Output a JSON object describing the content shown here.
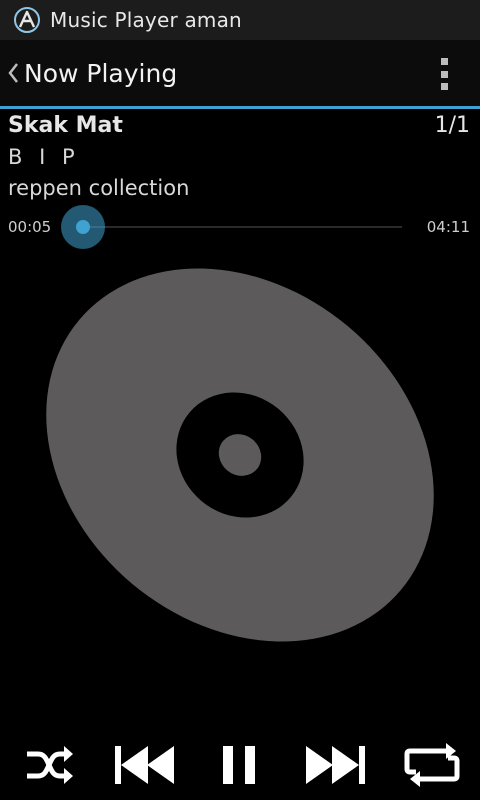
{
  "status_bar": {
    "app_title": "Music Player aman",
    "logo_icon": "app-logo-icon"
  },
  "action_bar": {
    "back_icon": "chevron-left-icon",
    "title": "Now Playing",
    "menu_icon": "overflow-menu-icon"
  },
  "track": {
    "title": "Skak Mat",
    "index": "1/1",
    "artist": "B I P",
    "album": "reppen collection"
  },
  "seek": {
    "elapsed": "00:05",
    "total": "04:11",
    "progress": 0.02
  },
  "album_art": {
    "icon": "disc-icon"
  },
  "controls": {
    "shuffle_icon": "shuffle-icon",
    "previous_icon": "skip-previous-icon",
    "pause_icon": "pause-icon",
    "next_icon": "skip-next-icon",
    "repeat_icon": "repeat-icon"
  },
  "colors": {
    "accent": "#3fa2d1",
    "disc": "#5c5a5a",
    "background": "#000000",
    "status_bar": "#1c1c1c"
  }
}
